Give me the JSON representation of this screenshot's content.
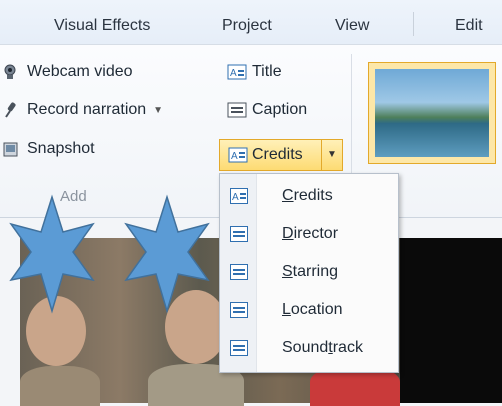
{
  "tabs": [
    {
      "label": "Visual Effects"
    },
    {
      "label": "Project"
    },
    {
      "label": "View"
    },
    {
      "label": "Edit"
    }
  ],
  "add_group": {
    "items": [
      {
        "label": "Webcam video",
        "icon": "webcam-icon"
      },
      {
        "label": "Record narration",
        "icon": "microphone-icon"
      },
      {
        "label": "Snapshot",
        "icon": "snapshot-icon"
      }
    ],
    "title_button": {
      "label": "Title",
      "icon": "title-icon"
    },
    "caption_button": {
      "label": "Caption",
      "icon": "caption-icon"
    },
    "credits_button": {
      "label": "Credits",
      "icon": "credits-icon"
    },
    "group_label": "Add"
  },
  "credits_menu": {
    "items": [
      {
        "label": "Credits",
        "accel": "C"
      },
      {
        "label": "Director",
        "accel": "D"
      },
      {
        "label": "Starring",
        "accel": "S"
      },
      {
        "label": "Location",
        "accel": "L"
      },
      {
        "label": "Soundtrack",
        "accel": "t"
      }
    ]
  },
  "colors": {
    "accent": "#fddb73",
    "accent_border": "#e3a92b",
    "star_fill": "#5b9bd5",
    "star_stroke": "#41719c",
    "icon_blue": "#2f6fb0"
  }
}
